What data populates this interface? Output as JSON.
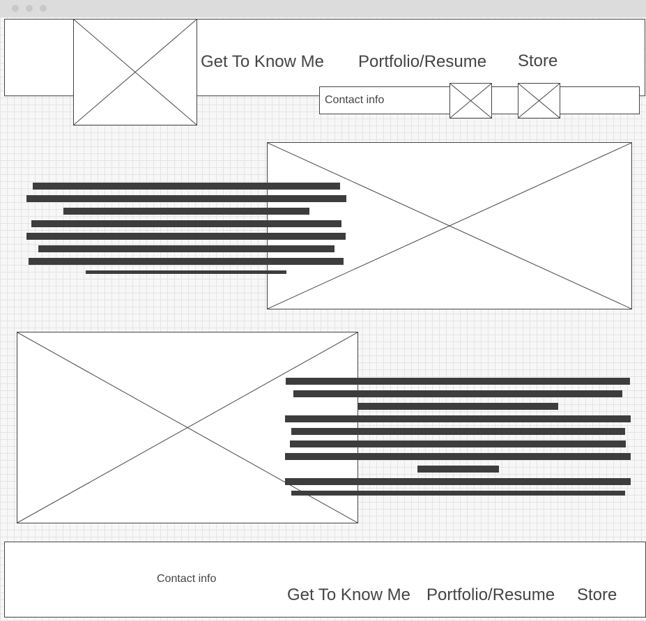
{
  "header": {
    "nav": [
      "Get To Know Me",
      "Portfolio/Resume",
      "Store"
    ],
    "contact_label": "Contact info"
  },
  "section1": {
    "text_lines": 8
  },
  "section2": {
    "text_lines": 10
  },
  "footer": {
    "contact_label": "Contact info",
    "nav": [
      "Get To Know Me",
      "Portfolio/Resume",
      "Store"
    ]
  },
  "colors": {
    "stroke": "#444444",
    "text_bar": "#3d3d3d",
    "grid": "#e4e4e4",
    "background": "#f7f7f7"
  }
}
